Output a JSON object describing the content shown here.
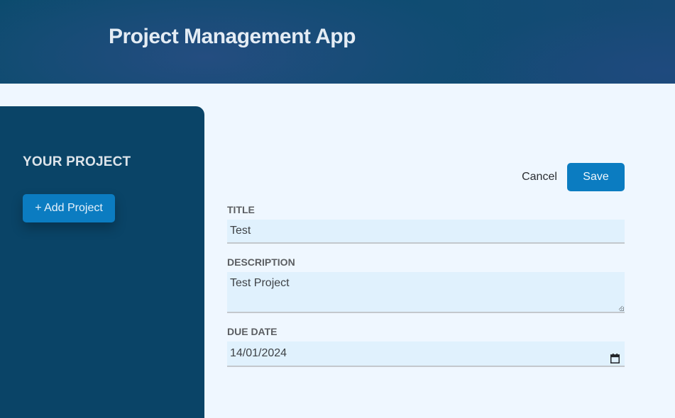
{
  "header": {
    "title": "Project Management App"
  },
  "sidebar": {
    "heading": "YOUR PROJECT",
    "add_button": "+ Add Project"
  },
  "form": {
    "cancel_label": "Cancel",
    "save_label": "Save",
    "title": {
      "label": "TITLE",
      "value": "Test"
    },
    "description": {
      "label": "DESCRIPTION",
      "value": "Test Project"
    },
    "due_date": {
      "label": "DUE DATE",
      "value": "14/01/2024",
      "icon": "calendar-icon"
    }
  },
  "colors": {
    "header_bg": "#0c4b6e",
    "sidebar_bg": "#0a4467",
    "accent": "#0b7cc1",
    "page_bg": "#eff7ff",
    "input_bg": "#e0f1fd"
  }
}
